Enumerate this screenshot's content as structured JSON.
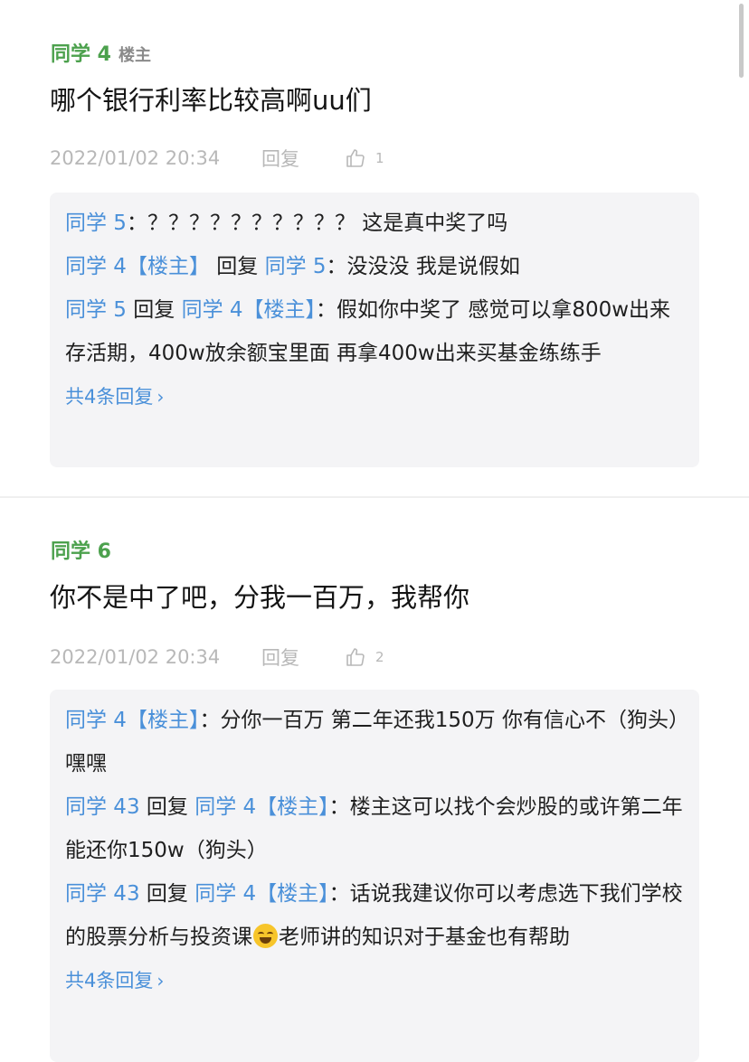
{
  "post1": {
    "author": "同学 4",
    "tag": "楼主",
    "text": "哪个银行利率比较高啊uu们",
    "time": "2022/01/02 20:34",
    "reply_label": "回复",
    "likes": "1",
    "replies": [
      {
        "from": "同学 5",
        "to": "",
        "sep": "：",
        "text": "？？？？？？？？？？ 这是真中奖了吗"
      },
      {
        "from": "同学 4【楼主】",
        "to": "同学 5",
        "sep": "：",
        "text": "没没没 我是说假如"
      },
      {
        "from": "同学 5",
        "to": "同学 4【楼主】",
        "sep": "：",
        "text": "假如你中奖了 感觉可以拿800w出来存活期，400w放余额宝里面 再拿400w出来买基金练练手"
      }
    ],
    "more": "共4条回复"
  },
  "post2": {
    "author": "同学 6",
    "text": "你不是中了吧，分我一百万，我帮你",
    "time": "2022/01/02 20:34",
    "reply_label": "回复",
    "likes": "2",
    "replies": [
      {
        "from": "同学 4【楼主】",
        "to": "",
        "sep": "：",
        "text": "分你一百万 第二年还我150万 你有信心不（狗头）嘿嘿"
      },
      {
        "from": "同学 43",
        "to": "同学 4【楼主】",
        "sep": "：",
        "text": "楼主这可以找个会炒股的或许第二年能还你150w（狗头）"
      },
      {
        "from": "同学 43",
        "to": "同学 4【楼主】",
        "sep": "：",
        "text_before": "话说我建议你可以考虑选下我们学校的股票分析与投资课",
        "emoji": "laughing-tears-emoji",
        "text_after": "老师讲的知识对于基金也有帮助"
      }
    ],
    "more": "共4条回复"
  },
  "labels": {
    "reply_word": "回复"
  }
}
